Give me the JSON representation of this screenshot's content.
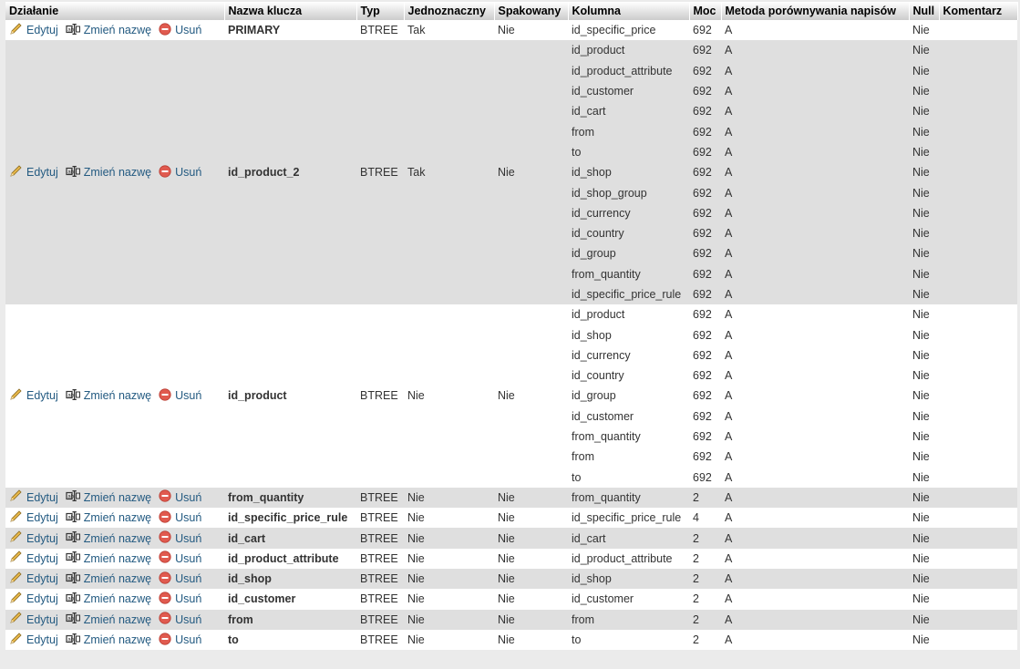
{
  "headers": {
    "action": "Działanie",
    "keyname": "Nazwa klucza",
    "type": "Typ",
    "unique": "Jednoznaczny",
    "packed": "Spakowany",
    "column": "Kolumna",
    "cardinality": "Moc",
    "collation": "Metoda porównywania napisów",
    "null": "Null",
    "comment": "Komentarz"
  },
  "actions": {
    "edit": "Edytuj",
    "rename": "Zmień nazwę",
    "drop": "Usuń"
  },
  "icons": {
    "edit": "pencil-icon",
    "rename": "rename-icon",
    "drop": "delete-icon"
  },
  "indexes": [
    {
      "name": "PRIMARY",
      "type": "BTREE",
      "unique": "Tak",
      "packed": "Nie",
      "columns": [
        {
          "col": "id_specific_price",
          "card": "692",
          "coll": "A",
          "nul": "Nie"
        }
      ]
    },
    {
      "name": "id_product_2",
      "type": "BTREE",
      "unique": "Tak",
      "packed": "Nie",
      "columns": [
        {
          "col": "id_product",
          "card": "692",
          "coll": "A",
          "nul": "Nie"
        },
        {
          "col": "id_product_attribute",
          "card": "692",
          "coll": "A",
          "nul": "Nie"
        },
        {
          "col": "id_customer",
          "card": "692",
          "coll": "A",
          "nul": "Nie"
        },
        {
          "col": "id_cart",
          "card": "692",
          "coll": "A",
          "nul": "Nie"
        },
        {
          "col": "from",
          "card": "692",
          "coll": "A",
          "nul": "Nie"
        },
        {
          "col": "to",
          "card": "692",
          "coll": "A",
          "nul": "Nie"
        },
        {
          "col": "id_shop",
          "card": "692",
          "coll": "A",
          "nul": "Nie"
        },
        {
          "col": "id_shop_group",
          "card": "692",
          "coll": "A",
          "nul": "Nie"
        },
        {
          "col": "id_currency",
          "card": "692",
          "coll": "A",
          "nul": "Nie"
        },
        {
          "col": "id_country",
          "card": "692",
          "coll": "A",
          "nul": "Nie"
        },
        {
          "col": "id_group",
          "card": "692",
          "coll": "A",
          "nul": "Nie"
        },
        {
          "col": "from_quantity",
          "card": "692",
          "coll": "A",
          "nul": "Nie"
        },
        {
          "col": "id_specific_price_rule",
          "card": "692",
          "coll": "A",
          "nul": "Nie"
        }
      ]
    },
    {
      "name": "id_product",
      "type": "BTREE",
      "unique": "Nie",
      "packed": "Nie",
      "columns": [
        {
          "col": "id_product",
          "card": "692",
          "coll": "A",
          "nul": "Nie"
        },
        {
          "col": "id_shop",
          "card": "692",
          "coll": "A",
          "nul": "Nie"
        },
        {
          "col": "id_currency",
          "card": "692",
          "coll": "A",
          "nul": "Nie"
        },
        {
          "col": "id_country",
          "card": "692",
          "coll": "A",
          "nul": "Nie"
        },
        {
          "col": "id_group",
          "card": "692",
          "coll": "A",
          "nul": "Nie"
        },
        {
          "col": "id_customer",
          "card": "692",
          "coll": "A",
          "nul": "Nie"
        },
        {
          "col": "from_quantity",
          "card": "692",
          "coll": "A",
          "nul": "Nie"
        },
        {
          "col": "from",
          "card": "692",
          "coll": "A",
          "nul": "Nie"
        },
        {
          "col": "to",
          "card": "692",
          "coll": "A",
          "nul": "Nie"
        }
      ]
    },
    {
      "name": "from_quantity",
      "type": "BTREE",
      "unique": "Nie",
      "packed": "Nie",
      "columns": [
        {
          "col": "from_quantity",
          "card": "2",
          "coll": "A",
          "nul": "Nie"
        }
      ]
    },
    {
      "name": "id_specific_price_rule",
      "type": "BTREE",
      "unique": "Nie",
      "packed": "Nie",
      "columns": [
        {
          "col": "id_specific_price_rule",
          "card": "4",
          "coll": "A",
          "nul": "Nie"
        }
      ]
    },
    {
      "name": "id_cart",
      "type": "BTREE",
      "unique": "Nie",
      "packed": "Nie",
      "columns": [
        {
          "col": "id_cart",
          "card": "2",
          "coll": "A",
          "nul": "Nie"
        }
      ]
    },
    {
      "name": "id_product_attribute",
      "type": "BTREE",
      "unique": "Nie",
      "packed": "Nie",
      "columns": [
        {
          "col": "id_product_attribute",
          "card": "2",
          "coll": "A",
          "nul": "Nie"
        }
      ]
    },
    {
      "name": "id_shop",
      "type": "BTREE",
      "unique": "Nie",
      "packed": "Nie",
      "columns": [
        {
          "col": "id_shop",
          "card": "2",
          "coll": "A",
          "nul": "Nie"
        }
      ]
    },
    {
      "name": "id_customer",
      "type": "BTREE",
      "unique": "Nie",
      "packed": "Nie",
      "columns": [
        {
          "col": "id_customer",
          "card": "2",
          "coll": "A",
          "nul": "Nie"
        }
      ]
    },
    {
      "name": "from",
      "type": "BTREE",
      "unique": "Nie",
      "packed": "Nie",
      "columns": [
        {
          "col": "from",
          "card": "2",
          "coll": "A",
          "nul": "Nie"
        }
      ]
    },
    {
      "name": "to",
      "type": "BTREE",
      "unique": "Nie",
      "packed": "Nie",
      "columns": [
        {
          "col": "to",
          "card": "2",
          "coll": "A",
          "nul": "Nie"
        }
      ]
    }
  ]
}
